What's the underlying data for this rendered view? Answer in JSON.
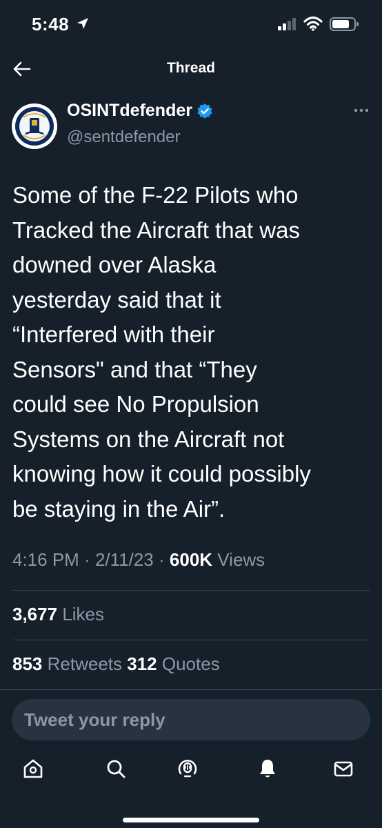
{
  "status_bar": {
    "time": "5:48"
  },
  "header": {
    "title": "Thread"
  },
  "author": {
    "display_name": "OSINTdefender",
    "handle": "@sentdefender"
  },
  "tweet": {
    "text": "Some of the F-22 Pilots who\nTracked the Aircraft that was\ndowned over Alaska\nyesterday said that it\n“Interfered with their\nSensors\" and that “They\ncould see No Propulsion\nSystems on the Aircraft not\nknowing how it could possibly\nbe staying in the Air”.",
    "time": "4:16 PM",
    "date": "2/11/23",
    "views_count": "600K",
    "views_label": "Views"
  },
  "stats": {
    "likes_count": "3,677",
    "likes_label": "Likes",
    "retweets_count": "853",
    "retweets_label": "Retweets",
    "quotes_count": "312",
    "quotes_label": "Quotes"
  },
  "reply": {
    "placeholder": "Tweet your reply"
  },
  "tabbar": {
    "items": [
      "home-icon",
      "search-icon",
      "spaces-icon",
      "notifications-icon",
      "messages-icon"
    ]
  },
  "colors": {
    "background": "#15202b",
    "secondary_text": "#8b98a5",
    "divider": "#38444d",
    "verified": "#1d9bf0",
    "reply_box": "#273340"
  }
}
